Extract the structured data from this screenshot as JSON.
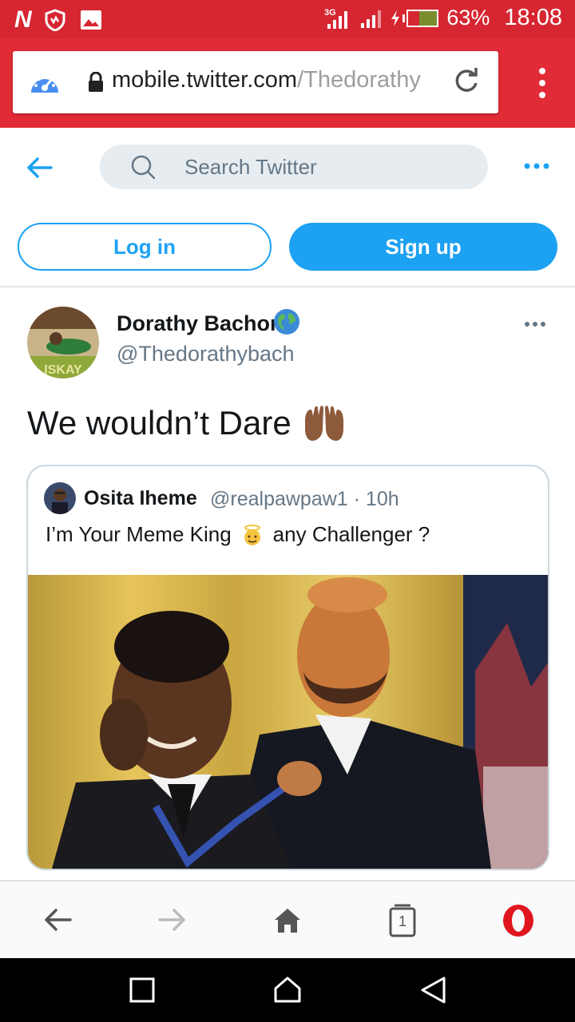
{
  "status_bar": {
    "brand_letter": "N",
    "network": "3G",
    "battery_percent": "63%",
    "time": "18:08",
    "background": "#d62631"
  },
  "browser": {
    "url_host": "mobile.twitter.com",
    "url_path": "/Thedorathy",
    "accent": "#e12b36"
  },
  "twitter": {
    "search_placeholder": "Search Twitter",
    "login_label": "Log in",
    "signup_label": "Sign up",
    "accent": "#1da1f2"
  },
  "tweet": {
    "author_name": "Dorathy Bachor",
    "author_handle": "@Thedorathybach",
    "verified_icon": "globe-icon",
    "avatar_banner_text": "ISKAY",
    "text": "We wouldn’t Dare",
    "emoji": "raising-hands-icon",
    "quote": {
      "author_name": "Osita Iheme",
      "meta": "@realpawpaw1 · 10h",
      "text_before": "I’m Your Meme King",
      "text_after": "any Challenger ?",
      "emoji": "angel-icon"
    }
  },
  "browser_nav": {
    "tab_count": "1",
    "items": [
      "back-icon",
      "forward-icon",
      "home-icon",
      "tabs-icon",
      "opera-icon"
    ]
  },
  "android_nav": {
    "items": [
      "recents-icon",
      "home-icon",
      "back-icon"
    ]
  }
}
